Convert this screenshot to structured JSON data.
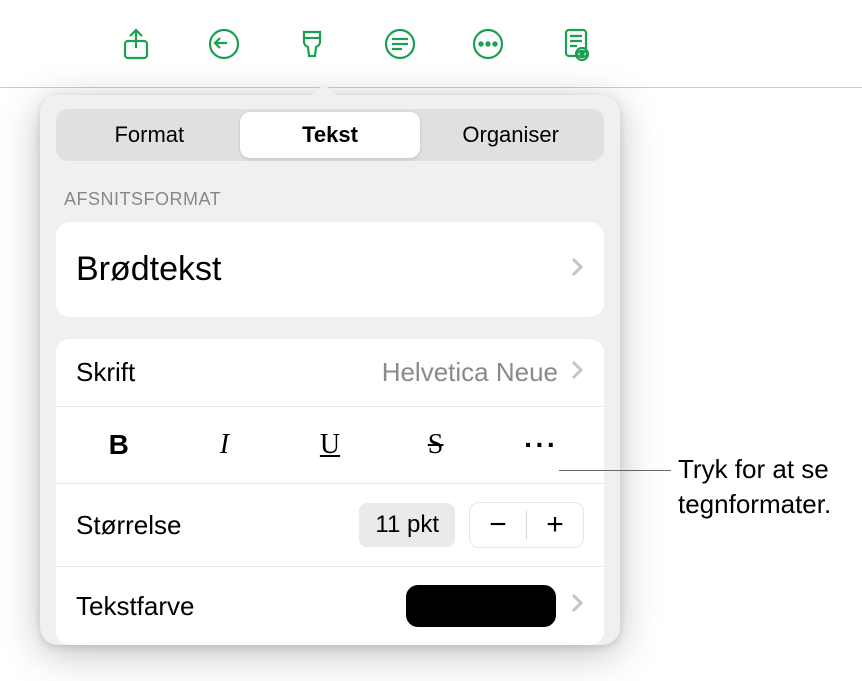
{
  "toolbar": {
    "icons": [
      "share-icon",
      "undo-icon",
      "format-brush-icon",
      "insert-icon",
      "more-icon",
      "document-view-icon"
    ]
  },
  "segmented": {
    "items": [
      "Format",
      "Tekst",
      "Organiser"
    ],
    "active_index": 1
  },
  "section_header": "AFSNITSFORMAT",
  "paragraph_style": "Brødtekst",
  "font": {
    "label": "Skrift",
    "value": "Helvetica Neue"
  },
  "style_buttons": {
    "bold": "B",
    "italic": "I",
    "underline": "U",
    "strike": "S",
    "more": "···"
  },
  "size": {
    "label": "Størrelse",
    "value": "11 pkt"
  },
  "text_color": {
    "label": "Tekstfarve",
    "swatch": "#000000"
  },
  "callout": {
    "line1": "Tryk for at se",
    "line2": "tegnformater."
  }
}
